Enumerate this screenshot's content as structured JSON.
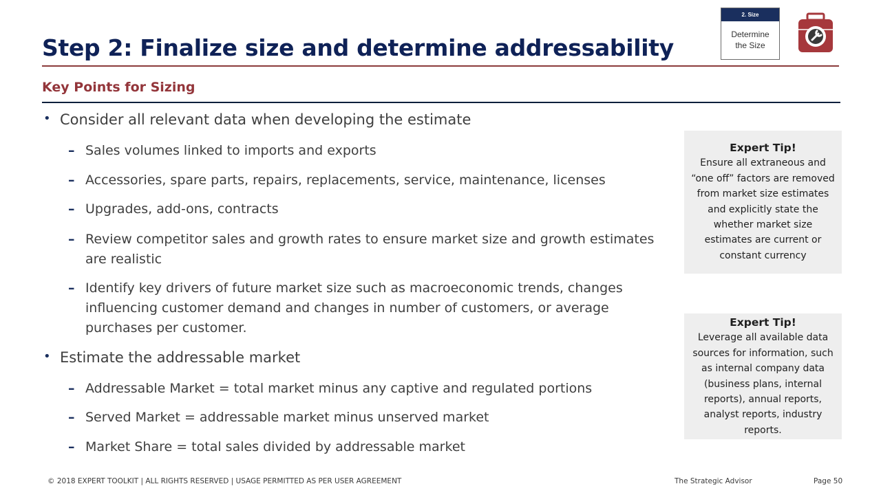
{
  "header": {
    "title": "Step 2: Finalize size and determine addressability",
    "subtitle": "Key Points for Sizing",
    "step_badge": {
      "label": "2. Size",
      "text_line1": "Determine",
      "text_line2": "the Size"
    },
    "icon": "toolbox-wrench-icon",
    "accent_colors": {
      "title": "#0f2257",
      "subtitle": "#93353a",
      "rule_red": "#8b3a3a",
      "rule_navy": "#0d1f3c"
    }
  },
  "content": {
    "sections": [
      {
        "text": "Consider all relevant data when developing the estimate",
        "items": [
          "Sales volumes linked to imports and exports",
          "Accessories, spare parts, repairs, replacements, service, maintenance, licenses",
          "Upgrades, add-ons, contracts",
          "Review competitor sales and growth rates to ensure market size and growth estimates are realistic",
          "Identify key drivers of future market size such as macroeconomic trends, changes influencing customer demand and changes in number of customers, or average purchases per customer."
        ]
      },
      {
        "text": "Estimate the addressable market",
        "items": [
          "Addressable Market = total market minus any captive and regulated portions",
          "Served Market = addressable market minus unserved market",
          "Market Share = total sales divided by addressable market"
        ]
      }
    ],
    "bullet_glyph": "•",
    "dash_glyph": "–"
  },
  "tips": [
    {
      "title": "Expert Tip!",
      "body": "Ensure all extraneous and “one off” factors are removed from market size estimates and explicitly state the whether market size estimates are current or constant currency"
    },
    {
      "title": "Expert Tip!",
      "body": "Leverage all available data sources for information, such as internal company data (business plans, internal reports), annual reports, analyst reports, industry reports."
    }
  ],
  "footer": {
    "copyright": "© 2018 EXPERT TOOLKIT | ALL RIGHTS RESERVED | USAGE PERMITTED AS PER USER AGREEMENT",
    "brand": "The Strategic Advisor",
    "page": "Page 50"
  }
}
